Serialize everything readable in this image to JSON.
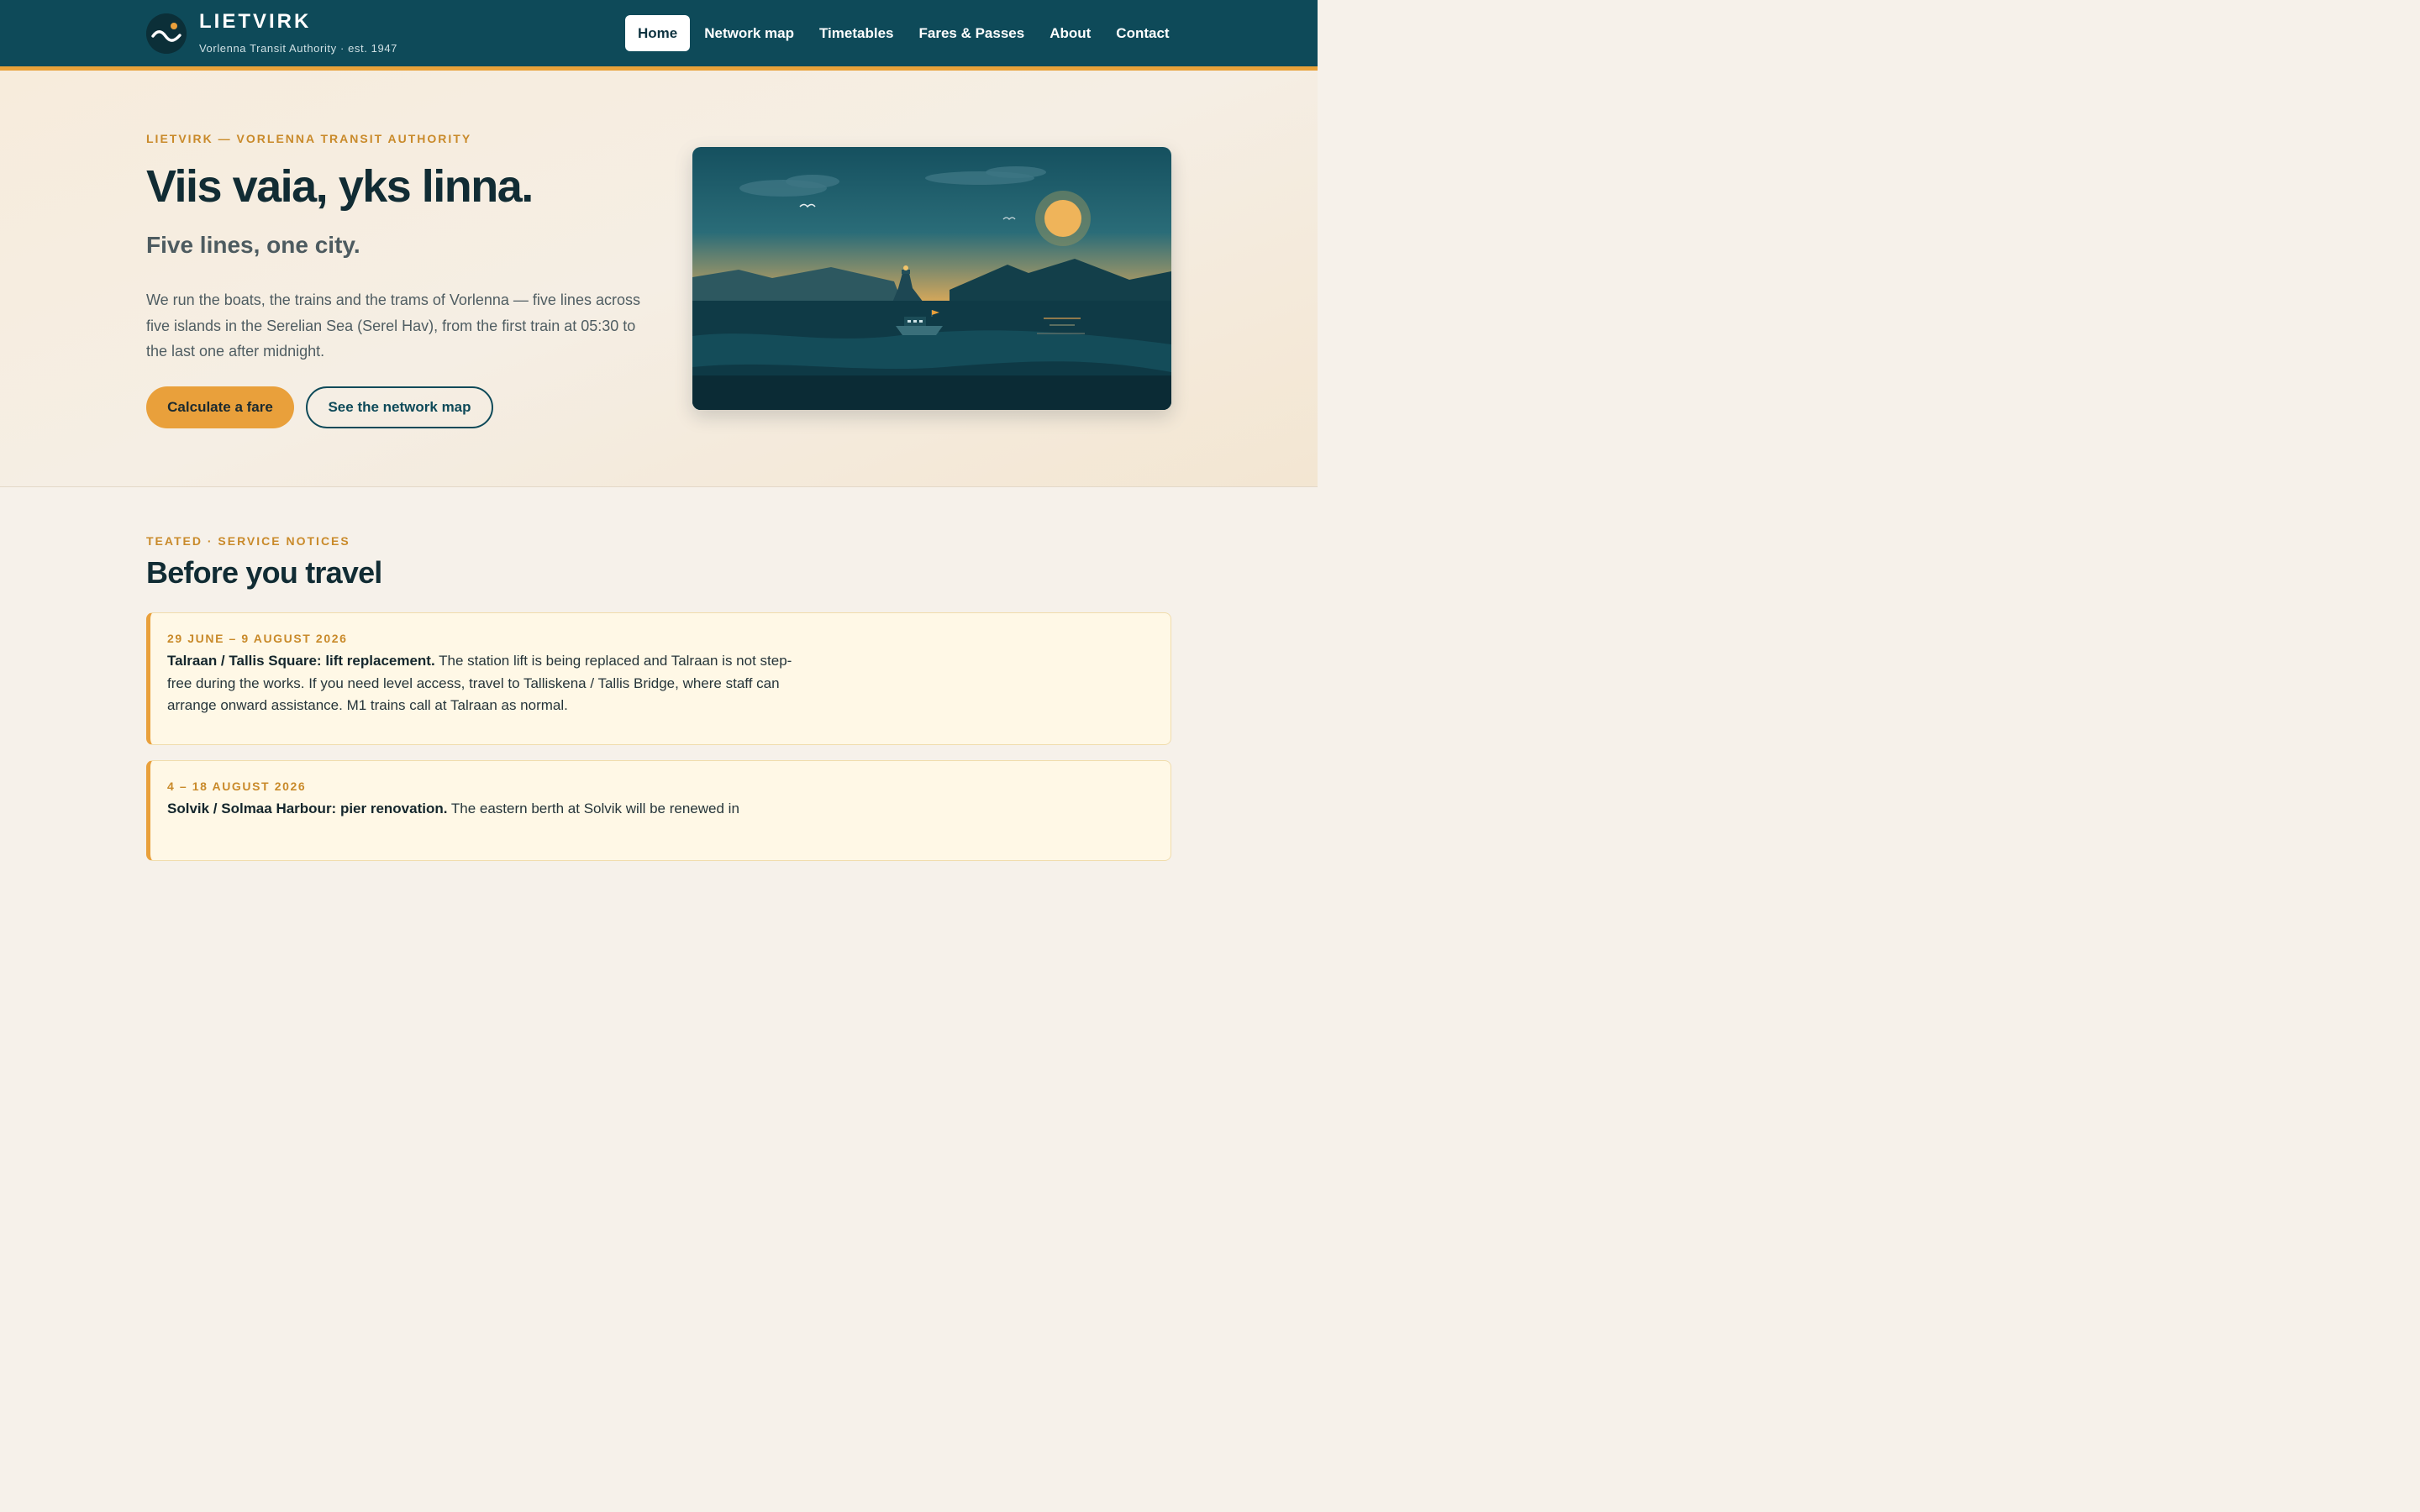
{
  "brand": {
    "name": "LIETVIRK",
    "subtitle": "Vorlenna Transit Authority · est. 1947"
  },
  "nav": {
    "items": [
      "Home",
      "Network map",
      "Timetables",
      "Fares & Passes",
      "About",
      "Contact"
    ],
    "active": "Home"
  },
  "hero": {
    "eyebrow": "LIETVIRK — VORLENNA TRANSIT AUTHORITY",
    "title": "Viis vaia, yks linna.",
    "subtitle": "Five lines, one city.",
    "body": "We run the boats, the trains and the trams of Vorlenna — five lines across five islands in the Serelian Sea (Serel Hav), from the first train at 05:30 to the last one after midnight.",
    "primary_button": "Calculate a fare",
    "secondary_button": "See the network map"
  },
  "notices": {
    "eyebrow": "TEATED · SERVICE NOTICES",
    "title": "Before you travel",
    "items": [
      {
        "date": "29 JUNE – 9 AUGUST 2026",
        "headline": "Talraan / Tallis Square: lift replacement.",
        "text": " The station lift is being replaced and Talraan is not step-free during the works. If you need level access, travel to Talliskena / Tallis Bridge, where staff can arrange onward assistance. M1 trains call at Talraan as normal."
      },
      {
        "date": "4 – 18 AUGUST 2026",
        "headline": "Solvik / Solmaa Harbour: pier renovation.",
        "text": " The eastern berth at Solvik will be renewed in"
      }
    ]
  },
  "colors": {
    "header": "#0e4a59",
    "accent": "#e9a03b",
    "title": "#112c34",
    "notice_bg": "#fff8e6"
  },
  "icons": {
    "logo": "sun-over-wave-icon"
  }
}
